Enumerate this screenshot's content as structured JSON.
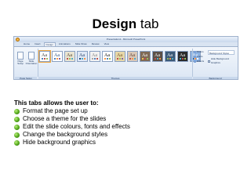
{
  "slide": {
    "title_bold": "Design",
    "title_rest": " tab",
    "heading": "This tabs allows the user to:",
    "bullets": [
      "Format the page set up",
      "Choose a theme for the slides",
      "Edit the slide colours, fonts and effects",
      "Change the background styles",
      "Hide background graphics"
    ]
  },
  "ribbon": {
    "window_title": "Presentation1 - Microsoft PowerPoint",
    "tabs": [
      "Home",
      "Insert",
      "Design",
      "Animations",
      "Slide Show",
      "Review",
      "View"
    ],
    "active_tab": "Design",
    "page_setup": {
      "buttons": [
        "Page Setup",
        "Slide Orientation"
      ],
      "group_label": "Page Setup"
    },
    "themes": {
      "group_label": "Themes",
      "items": [
        {
          "glyph": "Aa",
          "bg": "#ffffff",
          "fg": "#333333",
          "accent1": "#4f81bd",
          "accent2": "#c0504d",
          "accent3": "#9bbb59"
        },
        {
          "glyph": "Aa",
          "bg": "#ffffff",
          "fg": "#1f497d",
          "accent1": "#4f81bd",
          "accent2": "#f79646",
          "accent3": "#8064a2"
        },
        {
          "glyph": "Aa",
          "bg": "#e9e4d2",
          "fg": "#4a3a22",
          "accent1": "#c0504d",
          "accent2": "#9bbb59",
          "accent3": "#4bacc6"
        },
        {
          "glyph": "Aa",
          "bg": "#dfe8f5",
          "fg": "#203b63",
          "accent1": "#1f497d",
          "accent2": "#4bacc6",
          "accent3": "#f79646"
        },
        {
          "glyph": "Aa",
          "bg": "#f2f2f2",
          "fg": "#7f7f7f",
          "accent1": "#a5a5a5",
          "accent2": "#4f81bd",
          "accent3": "#c0504d"
        },
        {
          "glyph": "Aa",
          "bg": "#ffffff",
          "fg": "#000000",
          "accent1": "#f79646",
          "accent2": "#4f81bd",
          "accent3": "#9bbb59"
        },
        {
          "glyph": "Aa",
          "bg": "#e7d7a8",
          "fg": "#6b4f1d",
          "accent1": "#c0504d",
          "accent2": "#9bbb59",
          "accent3": "#8064a2"
        },
        {
          "glyph": "Aa",
          "bg": "#d9c7b7",
          "fg": "#5a3a2a",
          "accent1": "#c0504d",
          "accent2": "#f79646",
          "accent3": "#4bacc6"
        },
        {
          "glyph": "Aa",
          "bg": "#7f6a55",
          "fg": "#ffffff",
          "accent1": "#f2c04b",
          "accent2": "#c0504d",
          "accent3": "#9bbb59"
        },
        {
          "glyph": "Aa",
          "bg": "#5a4f47",
          "fg": "#ffffff",
          "accent1": "#c0504d",
          "accent2": "#4bacc6",
          "accent3": "#f79646"
        },
        {
          "glyph": "Aa",
          "bg": "#3c5a78",
          "fg": "#ffffff",
          "accent1": "#9bbb59",
          "accent2": "#f79646",
          "accent3": "#4bacc6"
        },
        {
          "glyph": "Aa",
          "bg": "#2b2b2b",
          "fg": "#ffffff",
          "accent1": "#4bacc6",
          "accent2": "#c0504d",
          "accent3": "#9bbb59"
        },
        {
          "glyph": "Aa",
          "bg": "#8db3e2",
          "fg": "#ffffff",
          "accent1": "#1f497d",
          "accent2": "#f79646",
          "accent3": "#ffffff"
        }
      ]
    },
    "background": {
      "options": [
        "Colors",
        "Fonts",
        "Effects"
      ],
      "styles_label": "Background Styles",
      "hide_label": "Hide Background Graphics",
      "group_label": "Background"
    }
  }
}
